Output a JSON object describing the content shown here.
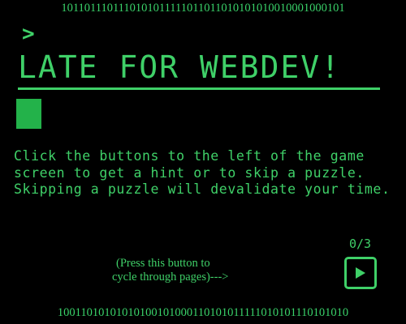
{
  "binary_top": "1011011101110101011111011011010101010010001000101",
  "binary_bottom": "10011010101010100101000110101011111010101110101010",
  "prompt_caret": ">",
  "title": "LATE FOR WEBDEV!",
  "instructions": "Click the buttons to the left of the game screen to get a hint or to skip a puzzle. Skipping a puzzle will devalidate your time.",
  "page_counter": "0/3",
  "cycle_hint": {
    "line1": "(Press this button to",
    "line2": "cycle through pages)--->"
  },
  "next_button_icon": "play-icon",
  "colors": {
    "background": "#000000",
    "accent": "#3fd068",
    "cursor": "#23b24a"
  }
}
